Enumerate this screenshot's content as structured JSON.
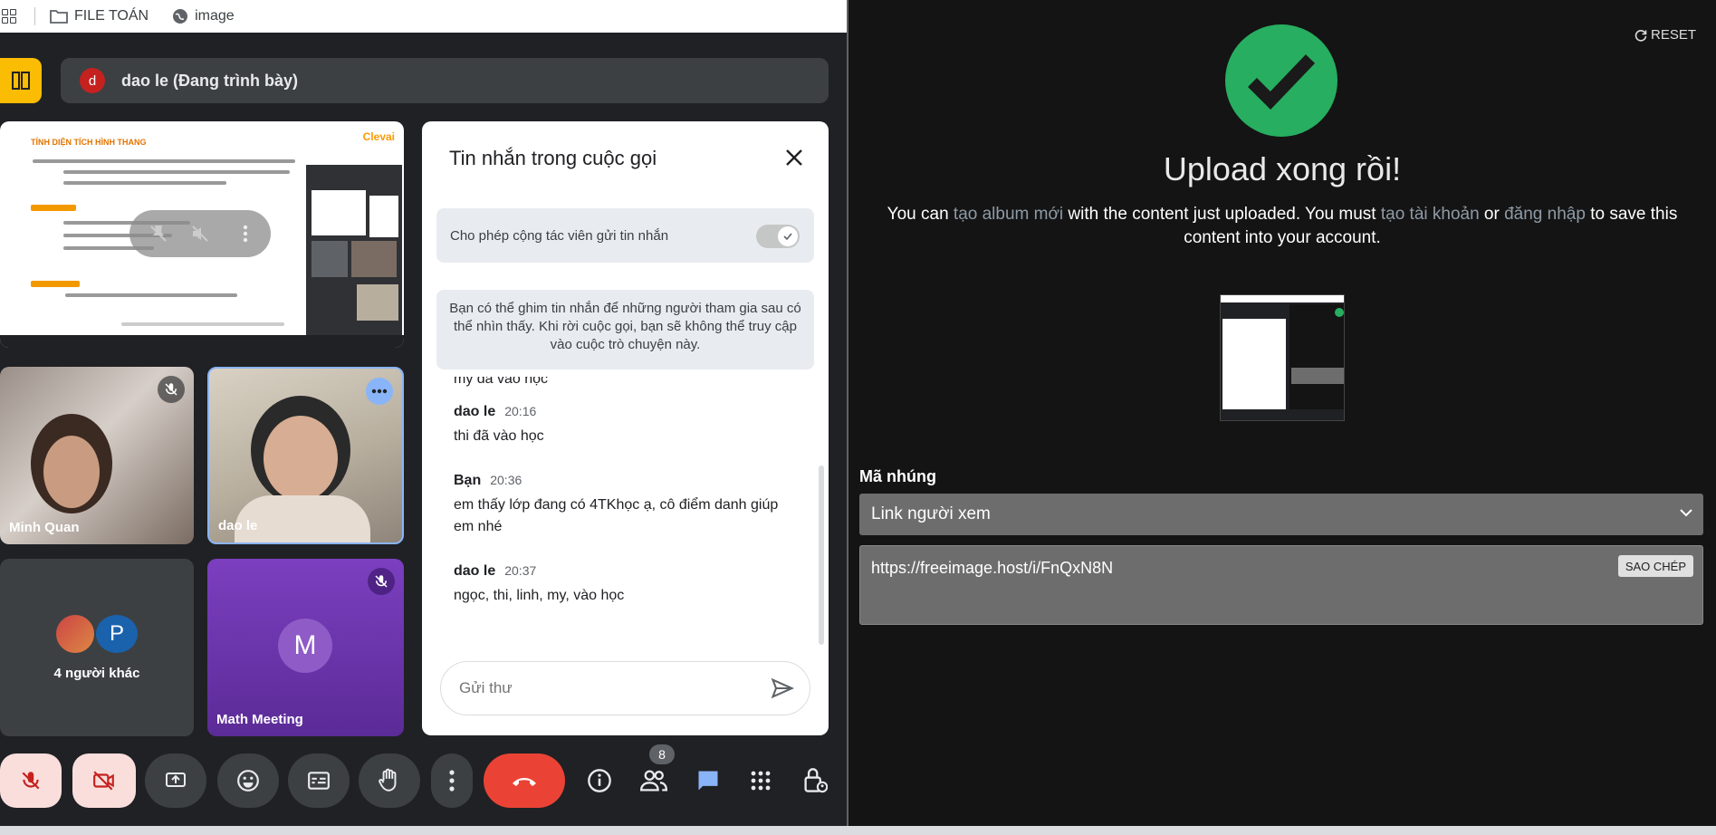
{
  "bookmarks": {
    "items": [
      {
        "icon": "folder-icon",
        "label": "FILE TOÁN"
      },
      {
        "icon": "globe-icon",
        "label": "image"
      }
    ]
  },
  "meet": {
    "presenter": {
      "avatar_letter": "d",
      "name": "dao le (Đang trình bày)"
    },
    "shared_screen": {
      "title": "TÍNH DIỆN TÍCH HÌNH THANG",
      "logo": "Clevai"
    },
    "tiles": [
      {
        "name": "Minh Quan",
        "muted": true
      },
      {
        "name": "dao le",
        "muted": false
      },
      {
        "name": "4 người khác",
        "avatar_letter": "P"
      },
      {
        "name": "Math Meeting",
        "avatar_letter": "M",
        "muted": true
      }
    ],
    "participant_count": "8",
    "chat": {
      "title": "Tin nhắn trong cuộc gọi",
      "allow_label": "Cho phép cộng tác viên gửi tin nhắn",
      "allow_enabled": true,
      "pin_note": "Bạn có thể ghim tin nhắn để những người tham gia sau có thể nhìn thấy. Khi rời cuộc gọi, bạn sẽ không thể truy cập vào cuộc trò chuyện này.",
      "cut_text": "my đã vào học",
      "messages": [
        {
          "sender": "dao le",
          "time": "20:16",
          "text": "thi đã vào học"
        },
        {
          "sender": "Bạn",
          "time": "20:36",
          "text": "em thấy lớp đang có 4TKhọc ạ, cô điểm danh giúp em nhé"
        },
        {
          "sender": "dao le",
          "time": "20:37",
          "text": "ngọc, thi, linh, my, vào học"
        }
      ],
      "input_placeholder": "Gửi thư"
    }
  },
  "upload": {
    "reset_label": "RESET",
    "title": "Upload xong rồi!",
    "desc_1": "You can ",
    "link_album": "tạo album mới",
    "desc_2": " with the content just uploaded. You must ",
    "link_account": "tạo tài khoản",
    "desc_3": " or ",
    "link_login": "đăng nhập",
    "desc_4": " to save this content into your account.",
    "embed_label": "Mã nhúng",
    "embed_select": "Link người xem",
    "embed_value": "https://freeimage.host/i/FnQxN8N",
    "copy_label": "SAO CHÉP"
  },
  "colors": {
    "success": "#27ae60",
    "end_call": "#ea4335",
    "accent_blue": "#8ab4f8",
    "layout_yellow": "#fbbc04"
  }
}
